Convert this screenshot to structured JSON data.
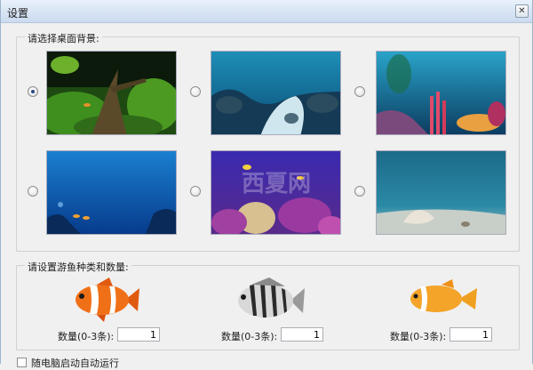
{
  "window": {
    "title": "设置",
    "close_symbol": "✕"
  },
  "background_group": {
    "legend": "请选择桌面背景:",
    "options": [
      {
        "id": "bg-1",
        "description": "green-plants-aquarium",
        "selected": true
      },
      {
        "id": "bg-2",
        "description": "blue-reef-sand",
        "selected": false
      },
      {
        "id": "bg-3",
        "description": "coral-reef",
        "selected": false
      },
      {
        "id": "bg-4",
        "description": "deep-blue-fish",
        "selected": false
      },
      {
        "id": "bg-5",
        "description": "purple-reef",
        "selected": false
      },
      {
        "id": "bg-6",
        "description": "seashell-sand",
        "selected": false
      }
    ],
    "watermark": "西夏网"
  },
  "fish_group": {
    "legend": "请设置游鱼种类和数量:",
    "items": [
      {
        "label": "数量(0-3条):",
        "value": "1",
        "fish": "clownfish"
      },
      {
        "label": "数量(0-3条):",
        "value": "1",
        "fish": "striped-damselfish"
      },
      {
        "label": "数量(0-3条):",
        "value": "1",
        "fish": "orange-clownfish"
      }
    ]
  },
  "autostart": {
    "label": "随电脑启动自动运行",
    "checked": false
  },
  "colors": {
    "title_bar": "#d6e3f3",
    "radio_dot": "#2b4a88"
  }
}
